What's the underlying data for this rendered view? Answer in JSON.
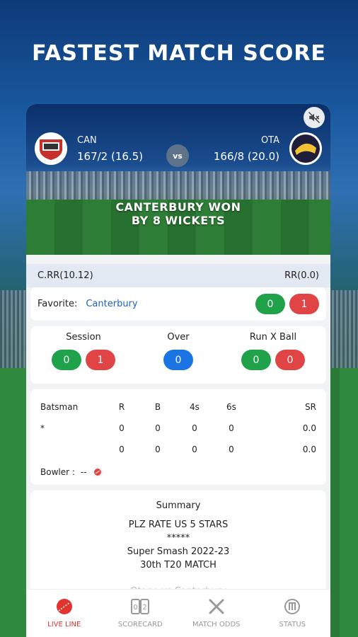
{
  "headline": "FASTEST MATCH SCORE",
  "match": {
    "team1": {
      "code": "CAN",
      "score": "167/2 (16.5)"
    },
    "team2": {
      "code": "OTA",
      "score": "166/8 (20.0)"
    },
    "vs": "vs",
    "result_line1": "CANTERBURY WON",
    "result_line2": "BY 8 WICKETS"
  },
  "rates": {
    "crr": "C.RR(10.12)",
    "rr": "RR(0.0)"
  },
  "favorite": {
    "label": "Favorite:",
    "team": "Canterbury",
    "back": "0",
    "lay": "1"
  },
  "session": {
    "session_label": "Session",
    "session_back": "0",
    "session_lay": "1",
    "over_label": "Over",
    "over_value": "0",
    "runxball_label": "Run X Ball",
    "runxball_back": "0",
    "runxball_lay": "0"
  },
  "batsmen": {
    "headers": [
      "Batsman",
      "R",
      "B",
      "4s",
      "6s",
      "SR"
    ],
    "rows": [
      [
        "*",
        "0",
        "0",
        "0",
        "0",
        "0.0"
      ],
      [
        "",
        "0",
        "0",
        "0",
        "0",
        "0.0"
      ]
    ],
    "bowler_label": "Bowler :",
    "bowler_value": "--"
  },
  "summary": {
    "title": "Summary",
    "line1": "PLZ RATE US 5 STARS",
    "line2": "*****",
    "line3": "Super Smash 2022-23",
    "line4": "30th T20 MATCH",
    "line5": "Otago vs Canterbury"
  },
  "nav": {
    "live": "LIVE LINE",
    "scorecard": "SCORECARD",
    "odds": "MATCH ODDS",
    "status": "STATUS"
  },
  "colors": {
    "green": "#20a24a",
    "red": "#e14444",
    "blue": "#1b74e4",
    "active": "#e0342f"
  }
}
